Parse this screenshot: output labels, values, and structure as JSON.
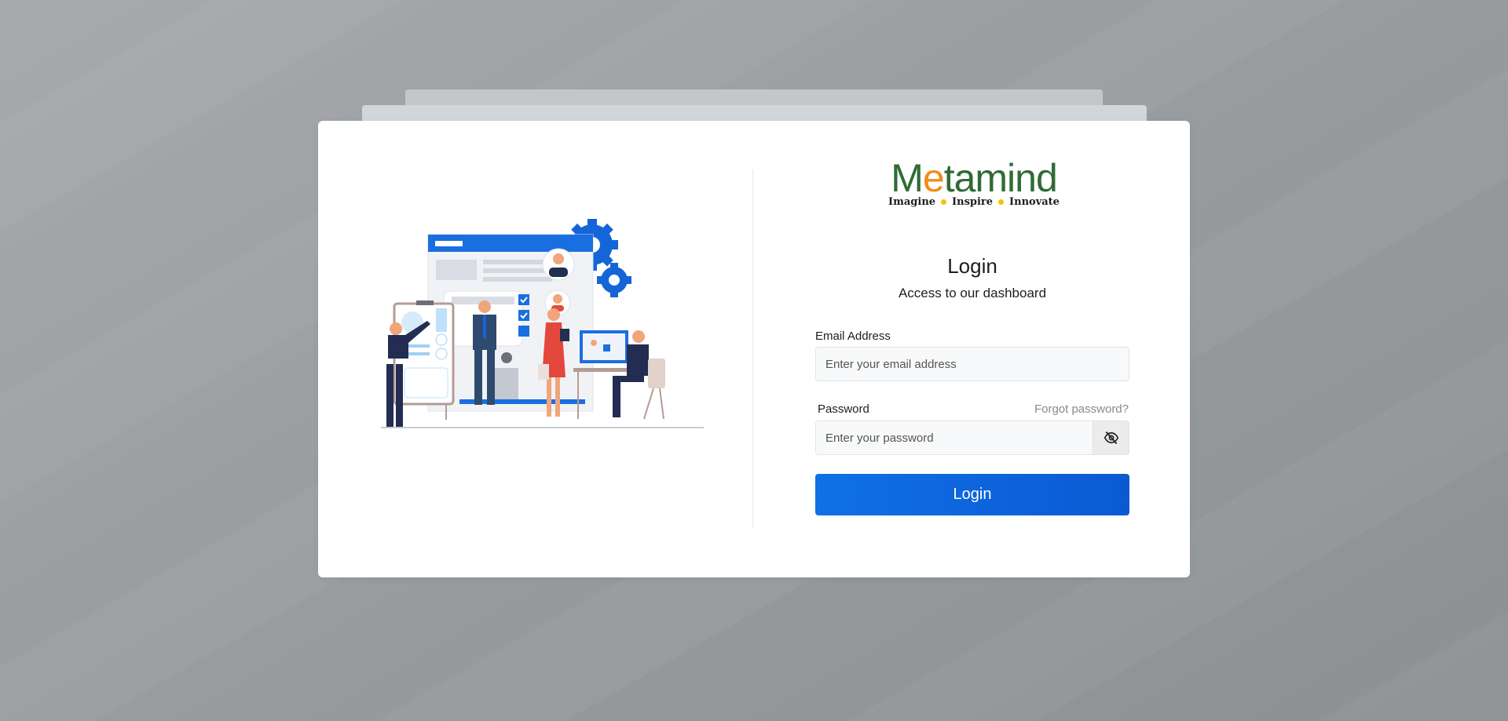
{
  "brand": {
    "logo_letters": [
      "M",
      "e",
      "ta",
      "mind"
    ],
    "tagline_words": [
      "Imagine",
      "Inspire",
      "Innovate"
    ],
    "colors": {
      "green": "#2f6b35",
      "orange": "#f08c1a",
      "dot": "#f2c400"
    }
  },
  "login": {
    "title": "Login",
    "subtitle": "Access to our dashboard",
    "email_label": "Email Address",
    "email_placeholder": "Enter your email address",
    "password_label": "Password",
    "forgot_label": "Forgot password?",
    "password_placeholder": "Enter your password",
    "toggle_icon": "eye-off-icon",
    "submit_label": "Login",
    "accent_color": "#0b5ad4"
  },
  "illustration": {
    "subject": "team-collaboration-illustration"
  }
}
